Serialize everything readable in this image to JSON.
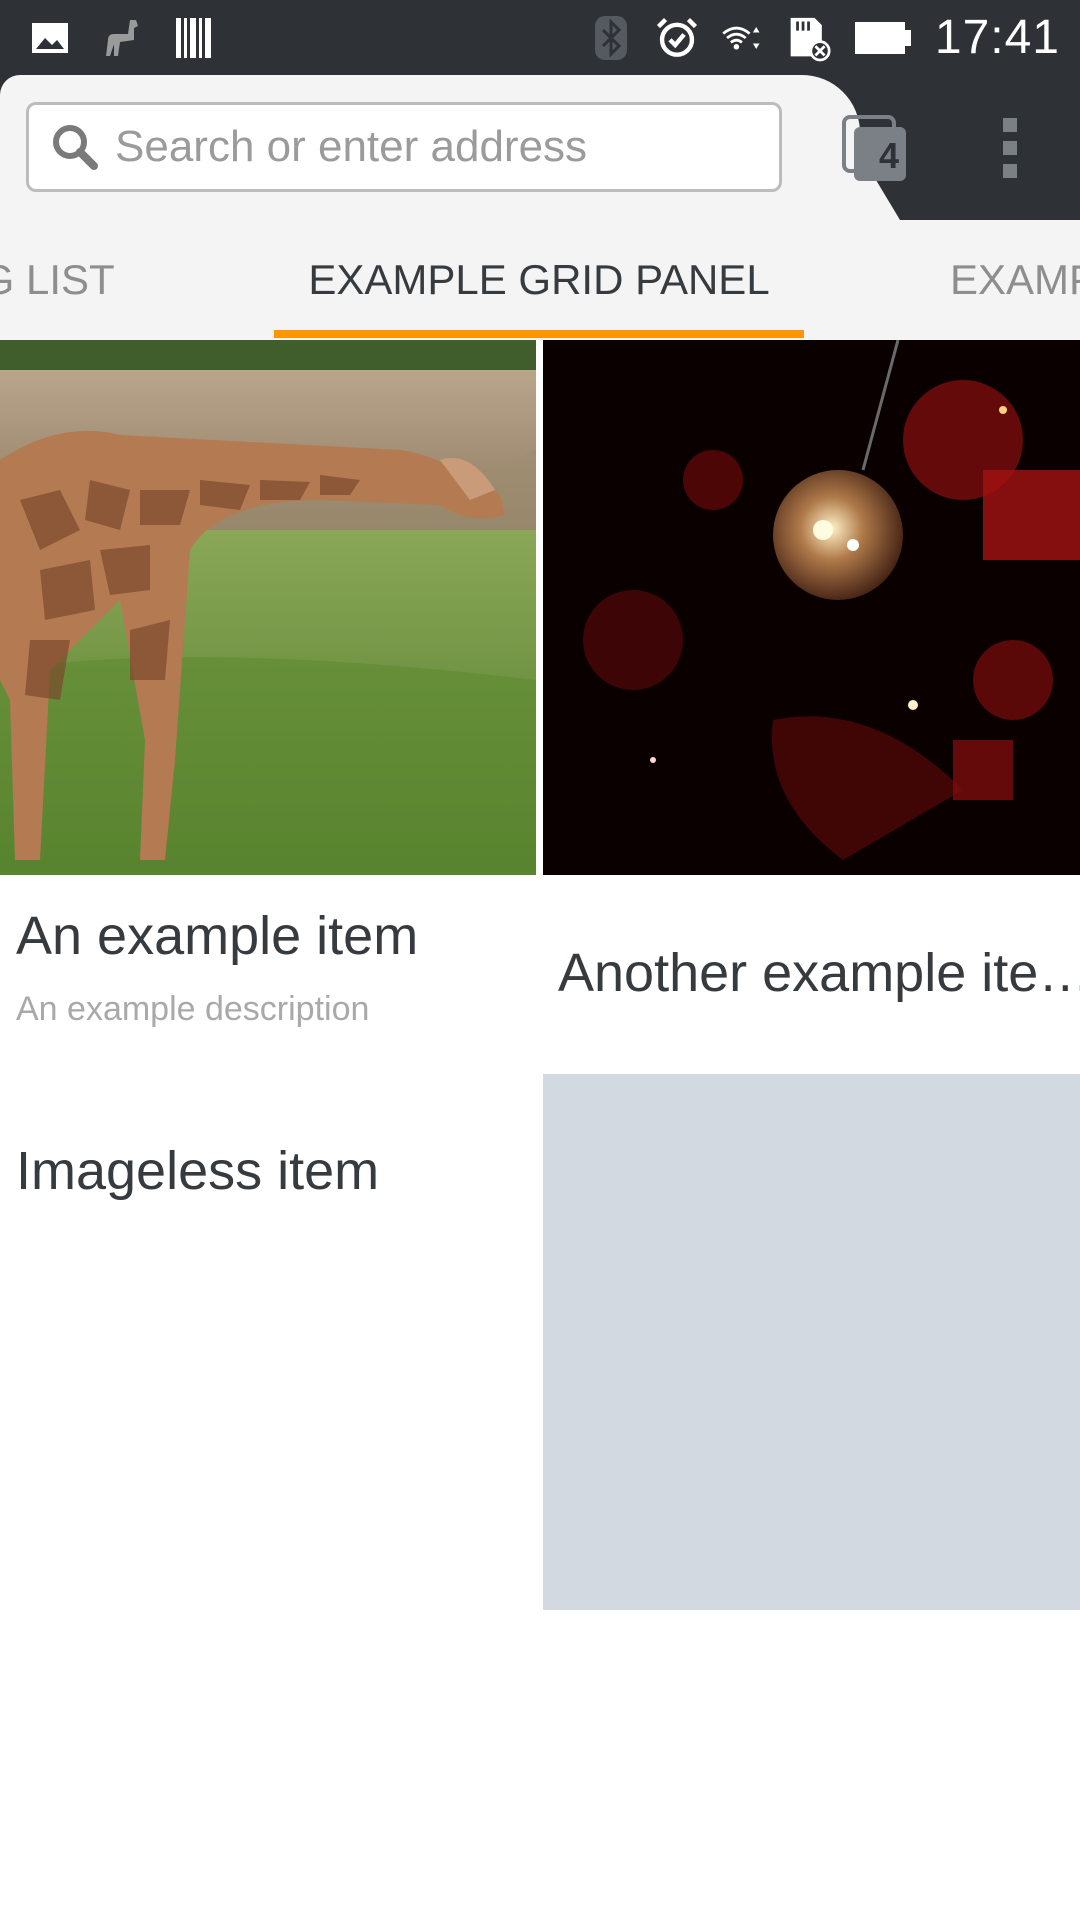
{
  "status_bar": {
    "time": "17:41",
    "left_icons": [
      "picture-notification-icon",
      "llama-notification-icon",
      "barcode-notification-icon"
    ],
    "right_icons": [
      "bluetooth-icon",
      "alarm-icon",
      "wifi-icon",
      "sd-card-error-icon",
      "battery-icon"
    ]
  },
  "toolbar": {
    "url_placeholder": "Search or enter address",
    "tabs_count": "4",
    "colors": {
      "background": "#2e3136",
      "url_bar_bg": "#f4f4f5"
    }
  },
  "tab_strip": {
    "tabs": [
      {
        "label": "IG LIST",
        "active": false
      },
      {
        "label": "EXAMPLE GRID PANEL",
        "active": true
      },
      {
        "label": "EXAMP",
        "active": false
      }
    ],
    "indicator_color": "#ff9500"
  },
  "grid": {
    "items": [
      {
        "title": "An example item",
        "description": "An example description",
        "image": "giraffe"
      },
      {
        "title": "Another example ite…",
        "description": "",
        "image": "disco-ball"
      },
      {
        "title": "Imageless item",
        "description": "",
        "image": ""
      },
      {
        "title": "",
        "description": "",
        "image": "placeholder"
      }
    ]
  }
}
